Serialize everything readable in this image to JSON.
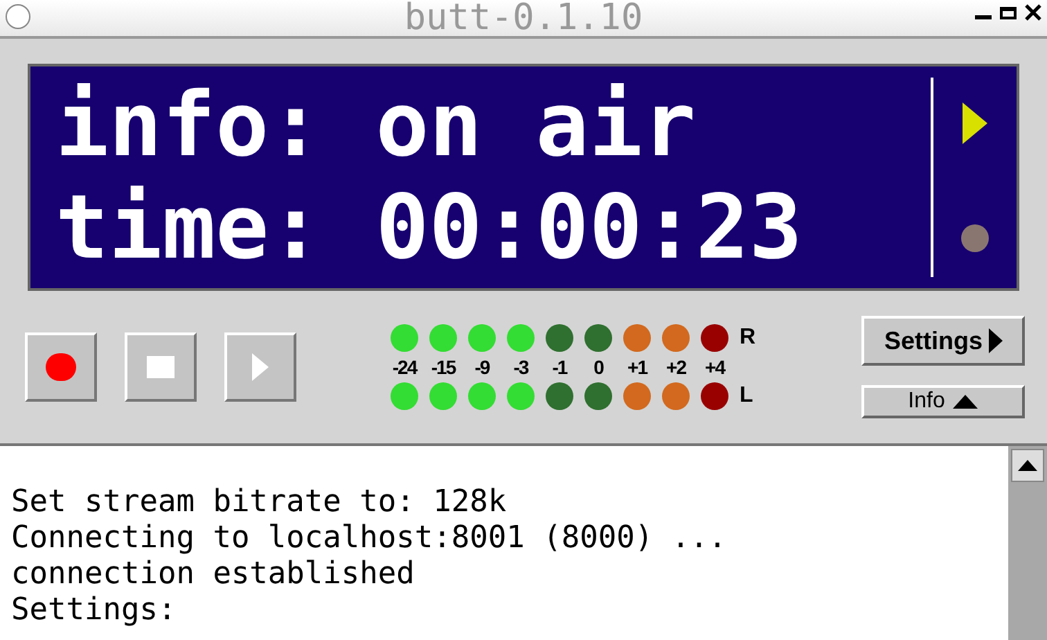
{
  "window": {
    "title": "butt-0.1.10"
  },
  "display": {
    "lines": [
      "info: on air",
      "time: 00:00:23"
    ]
  },
  "transport": [
    {
      "kind": "record"
    },
    {
      "kind": "stop"
    },
    {
      "kind": "play"
    }
  ],
  "meter": {
    "channels": [
      "R",
      "L"
    ],
    "columns": [
      {
        "label": "-24",
        "color": "#33dd33"
      },
      {
        "label": "-15",
        "color": "#33dd33"
      },
      {
        "label": "-9",
        "color": "#33dd33"
      },
      {
        "label": "-3",
        "color": "#33dd33"
      },
      {
        "label": "-1",
        "color": "#2f6f2f"
      },
      {
        "label": "0",
        "color": "#2f6f2f"
      },
      {
        "label": "+1",
        "color": "#d2691e"
      },
      {
        "label": "+2",
        "color": "#d2691e"
      },
      {
        "label": "+4",
        "color": "#990000"
      }
    ]
  },
  "buttons": {
    "settings": "Settings",
    "info": "Info"
  },
  "log": [
    "Set stream bitrate to: 128k",
    "Connecting to localhost:8001 (8000) ...",
    "connection established",
    "Settings:"
  ]
}
